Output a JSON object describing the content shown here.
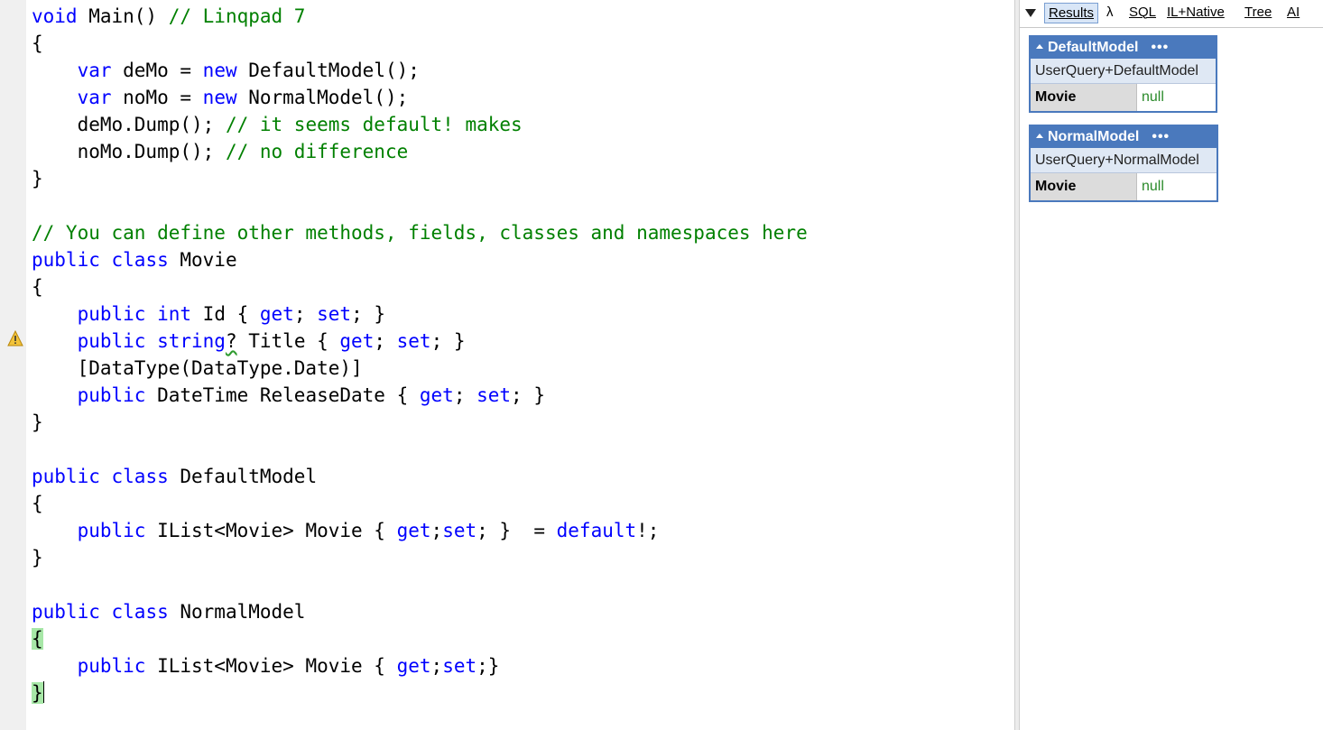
{
  "code_lines": [
    [
      {
        "t": "void",
        "c": "kw"
      },
      {
        "t": " Main() "
      },
      {
        "t": "// Linqpad 7",
        "c": "cm"
      }
    ],
    [
      {
        "t": "{"
      }
    ],
    [
      {
        "t": "    "
      },
      {
        "t": "var",
        "c": "kw"
      },
      {
        "t": " deMo = "
      },
      {
        "t": "new",
        "c": "kw"
      },
      {
        "t": " DefaultModel();"
      }
    ],
    [
      {
        "t": "    "
      },
      {
        "t": "var",
        "c": "kw"
      },
      {
        "t": " noMo = "
      },
      {
        "t": "new",
        "c": "kw"
      },
      {
        "t": " NormalModel();"
      }
    ],
    [
      {
        "t": "    deMo.Dump(); "
      },
      {
        "t": "// it seems default! makes",
        "c": "cm"
      }
    ],
    [
      {
        "t": "    noMo.Dump(); "
      },
      {
        "t": "// no difference",
        "c": "cm"
      }
    ],
    [
      {
        "t": "}"
      }
    ],
    [],
    [
      {
        "t": "// You can define other methods, fields, classes and namespaces here",
        "c": "cm"
      }
    ],
    [
      {
        "t": "public",
        "c": "kw"
      },
      {
        "t": " "
      },
      {
        "t": "class",
        "c": "kw"
      },
      {
        "t": " Movie"
      }
    ],
    [
      {
        "t": "{"
      }
    ],
    [
      {
        "t": "    "
      },
      {
        "t": "public",
        "c": "kw"
      },
      {
        "t": " "
      },
      {
        "t": "int",
        "c": "kw"
      },
      {
        "t": " Id { "
      },
      {
        "t": "get",
        "c": "kw"
      },
      {
        "t": "; "
      },
      {
        "t": "set",
        "c": "kw"
      },
      {
        "t": "; }"
      }
    ],
    [
      {
        "t": "    "
      },
      {
        "t": "public",
        "c": "kw"
      },
      {
        "t": " "
      },
      {
        "t": "string",
        "c": "kw"
      },
      {
        "t": "?",
        "c": "squiggle"
      },
      {
        "t": " Title { "
      },
      {
        "t": "get",
        "c": "kw"
      },
      {
        "t": "; "
      },
      {
        "t": "set",
        "c": "kw"
      },
      {
        "t": "; }"
      }
    ],
    [
      {
        "t": "    [DataType(DataType.Date)]"
      }
    ],
    [
      {
        "t": "    "
      },
      {
        "t": "public",
        "c": "kw"
      },
      {
        "t": " DateTime ReleaseDate { "
      },
      {
        "t": "get",
        "c": "kw"
      },
      {
        "t": "; "
      },
      {
        "t": "set",
        "c": "kw"
      },
      {
        "t": "; }"
      }
    ],
    [
      {
        "t": "}"
      }
    ],
    [],
    [
      {
        "t": "public",
        "c": "kw"
      },
      {
        "t": " "
      },
      {
        "t": "class",
        "c": "kw"
      },
      {
        "t": " DefaultModel"
      }
    ],
    [
      {
        "t": "{"
      }
    ],
    [
      {
        "t": "    "
      },
      {
        "t": "public",
        "c": "kw"
      },
      {
        "t": " IList<Movie> Movie { "
      },
      {
        "t": "get",
        "c": "kw"
      },
      {
        "t": ";"
      },
      {
        "t": "set",
        "c": "kw"
      },
      {
        "t": "; }  = "
      },
      {
        "t": "default",
        "c": "kw"
      },
      {
        "t": "!;"
      }
    ],
    [
      {
        "t": "}"
      }
    ],
    [],
    [
      {
        "t": "public",
        "c": "kw"
      },
      {
        "t": " "
      },
      {
        "t": "class",
        "c": "kw"
      },
      {
        "t": " NormalModel"
      }
    ],
    [
      {
        "t": "{",
        "c": "brace-hl"
      }
    ],
    [
      {
        "t": "    "
      },
      {
        "t": "public",
        "c": "kw"
      },
      {
        "t": " IList<Movie> Movie { "
      },
      {
        "t": "get",
        "c": "kw"
      },
      {
        "t": ";"
      },
      {
        "t": "set",
        "c": "kw"
      },
      {
        "t": ";}"
      }
    ],
    [
      {
        "t": "}",
        "c": "brace-hl"
      },
      {
        "t": "",
        "c": "caret"
      }
    ]
  ],
  "gutter": {
    "warning_icon": "warning-icon",
    "warning_color": "#f2c33a"
  },
  "results_tabs": [
    {
      "label": "Results",
      "active": true
    },
    {
      "label": "λ",
      "active": false
    },
    {
      "label": "SQL",
      "active": false
    },
    {
      "label": "IL+Native",
      "active": false
    },
    {
      "label": "Tree",
      "active": false
    },
    {
      "label": "AI",
      "active": false
    }
  ],
  "dumps": [
    {
      "title": "DefaultModel",
      "menu": "•••",
      "type": "UserQuery+DefaultModel",
      "prop": "Movie",
      "value": "null"
    },
    {
      "title": "NormalModel",
      "menu": "•••",
      "type": "UserQuery+NormalModel",
      "prop": "Movie",
      "value": "null"
    }
  ],
  "colors": {
    "keyword": "#0000ff",
    "comment": "#008000",
    "dump_header": "#4a79bd",
    "null_value": "#2a8a2a"
  }
}
